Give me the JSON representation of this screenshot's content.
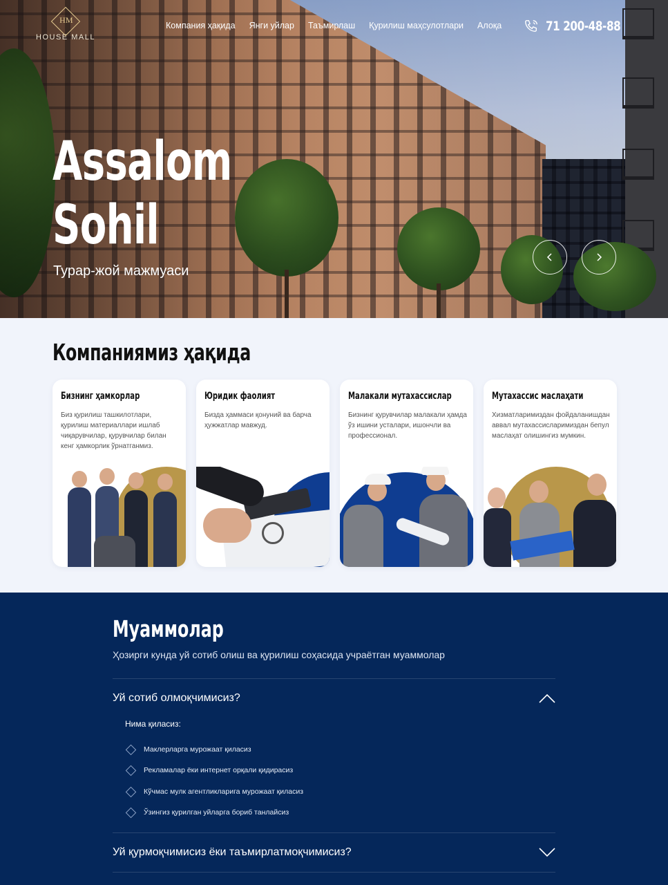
{
  "header": {
    "logo_text": "HOUSE MALL",
    "nav": [
      "Компания ҳақида",
      "Янги уйлар",
      "Таъмирлаш",
      "Қурилиш маҳсулотлари",
      "Алоқа"
    ],
    "phone": "71 200-48-88"
  },
  "hero": {
    "title_line1": "Assalom",
    "title_line2": "Sohil",
    "subtitle": "Турар-жой мажмуаси",
    "prev_icon": "chevron-left-icon",
    "next_icon": "chevron-right-icon"
  },
  "about": {
    "title": "Компаниямиз ҳақида",
    "cards": [
      {
        "title": "Бизнинг ҳамкорлар",
        "text": "Биз қурилиш ташкилотлари, қурилиш материаллари ишлаб чиқарувчилар, қурувчилар билан кенг ҳамкорлик ўрнатганмиз."
      },
      {
        "title": "Юридик фаолият",
        "text": "Бизда ҳаммаси қонуний ва барча ҳужжатлар мавжуд."
      },
      {
        "title": "Малакали мутахассислар",
        "text": "Бизнинг қурувчилар малакали ҳамда ўз ишини усталари, ишончли ва профессионал."
      },
      {
        "title": "Мутахассис маслаҳати",
        "text": "Хизматларимиздан фойдаланишдан аввал мутахассисларимиздан бепул маслаҳат олишингиз мумкин."
      }
    ]
  },
  "problems": {
    "title": "Муаммолар",
    "subtitle": "Ҳозирги кунда уй сотиб олиш ва қурилиш соҳасида учраётган муаммолар",
    "q1": "Уй сотиб олмоқчимисиз?",
    "answer_head": "Нима қиласиз:",
    "answers": [
      "Маклерларга мурожаат қиласиз",
      "Рекламалар ёки интернет орқали қидирасиз",
      "Кўчмас мулк агентликларига мурожаат қиласиз",
      "Ўзингиз қурилган уйларга бориб танлайсиз"
    ],
    "q2": "Уй қурмоқчимисиз ёки таъмирлатмоқчимисиз?"
  },
  "colors": {
    "navy": "#05275a",
    "gold": "#b9974a",
    "page_bg": "#f1f4fb"
  }
}
